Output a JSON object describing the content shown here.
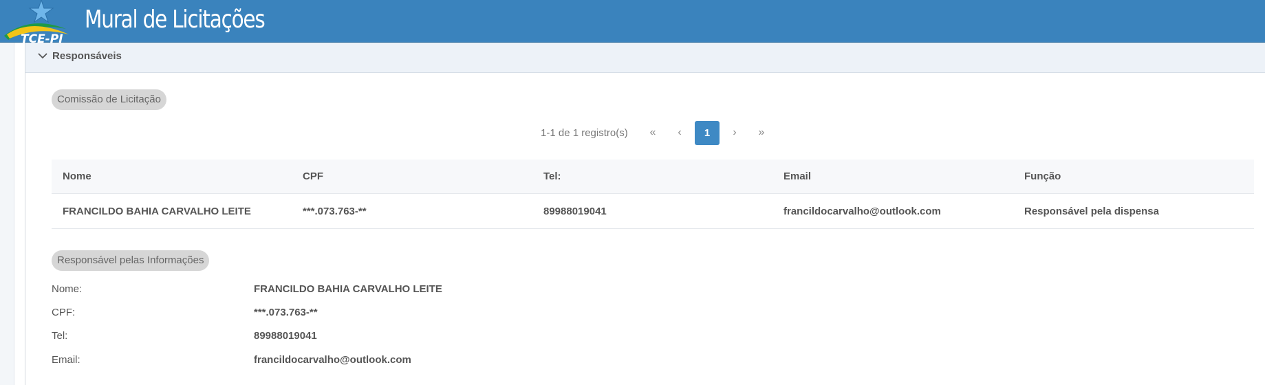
{
  "header": {
    "logo_text": "TCE-PI",
    "title": "Mural de Licitações",
    "background": "#3a83bd"
  },
  "section": {
    "title": "Responsáveis",
    "toggle_icon": "chevron-down-icon"
  },
  "commission": {
    "badge": "Comissão de Licitação",
    "pagination": {
      "info": "1-1 de 1 registro(s)",
      "first_icon": "«",
      "prev_icon": "‹",
      "current_page": "1",
      "next_icon": "›",
      "last_icon": "»",
      "accent": "#3e89c4"
    },
    "table": {
      "headers": [
        "Nome",
        "CPF",
        "Tel:",
        "Email",
        "Função"
      ],
      "rows": [
        [
          "FRANCILDO BAHIA CARVALHO LEITE",
          "***.073.763-**",
          "89988019041",
          "francildocarvalho@outlook.com",
          "Responsável pela dispensa"
        ]
      ]
    }
  },
  "info": {
    "badge": "Responsável pelas Informações",
    "fields": [
      {
        "label": "Nome:",
        "value": "FRANCILDO BAHIA CARVALHO LEITE"
      },
      {
        "label": "CPF:",
        "value": "***.073.763-**"
      },
      {
        "label": "Tel:",
        "value": "89988019041"
      },
      {
        "label": "Email:",
        "value": "francildocarvalho@outlook.com"
      }
    ]
  }
}
